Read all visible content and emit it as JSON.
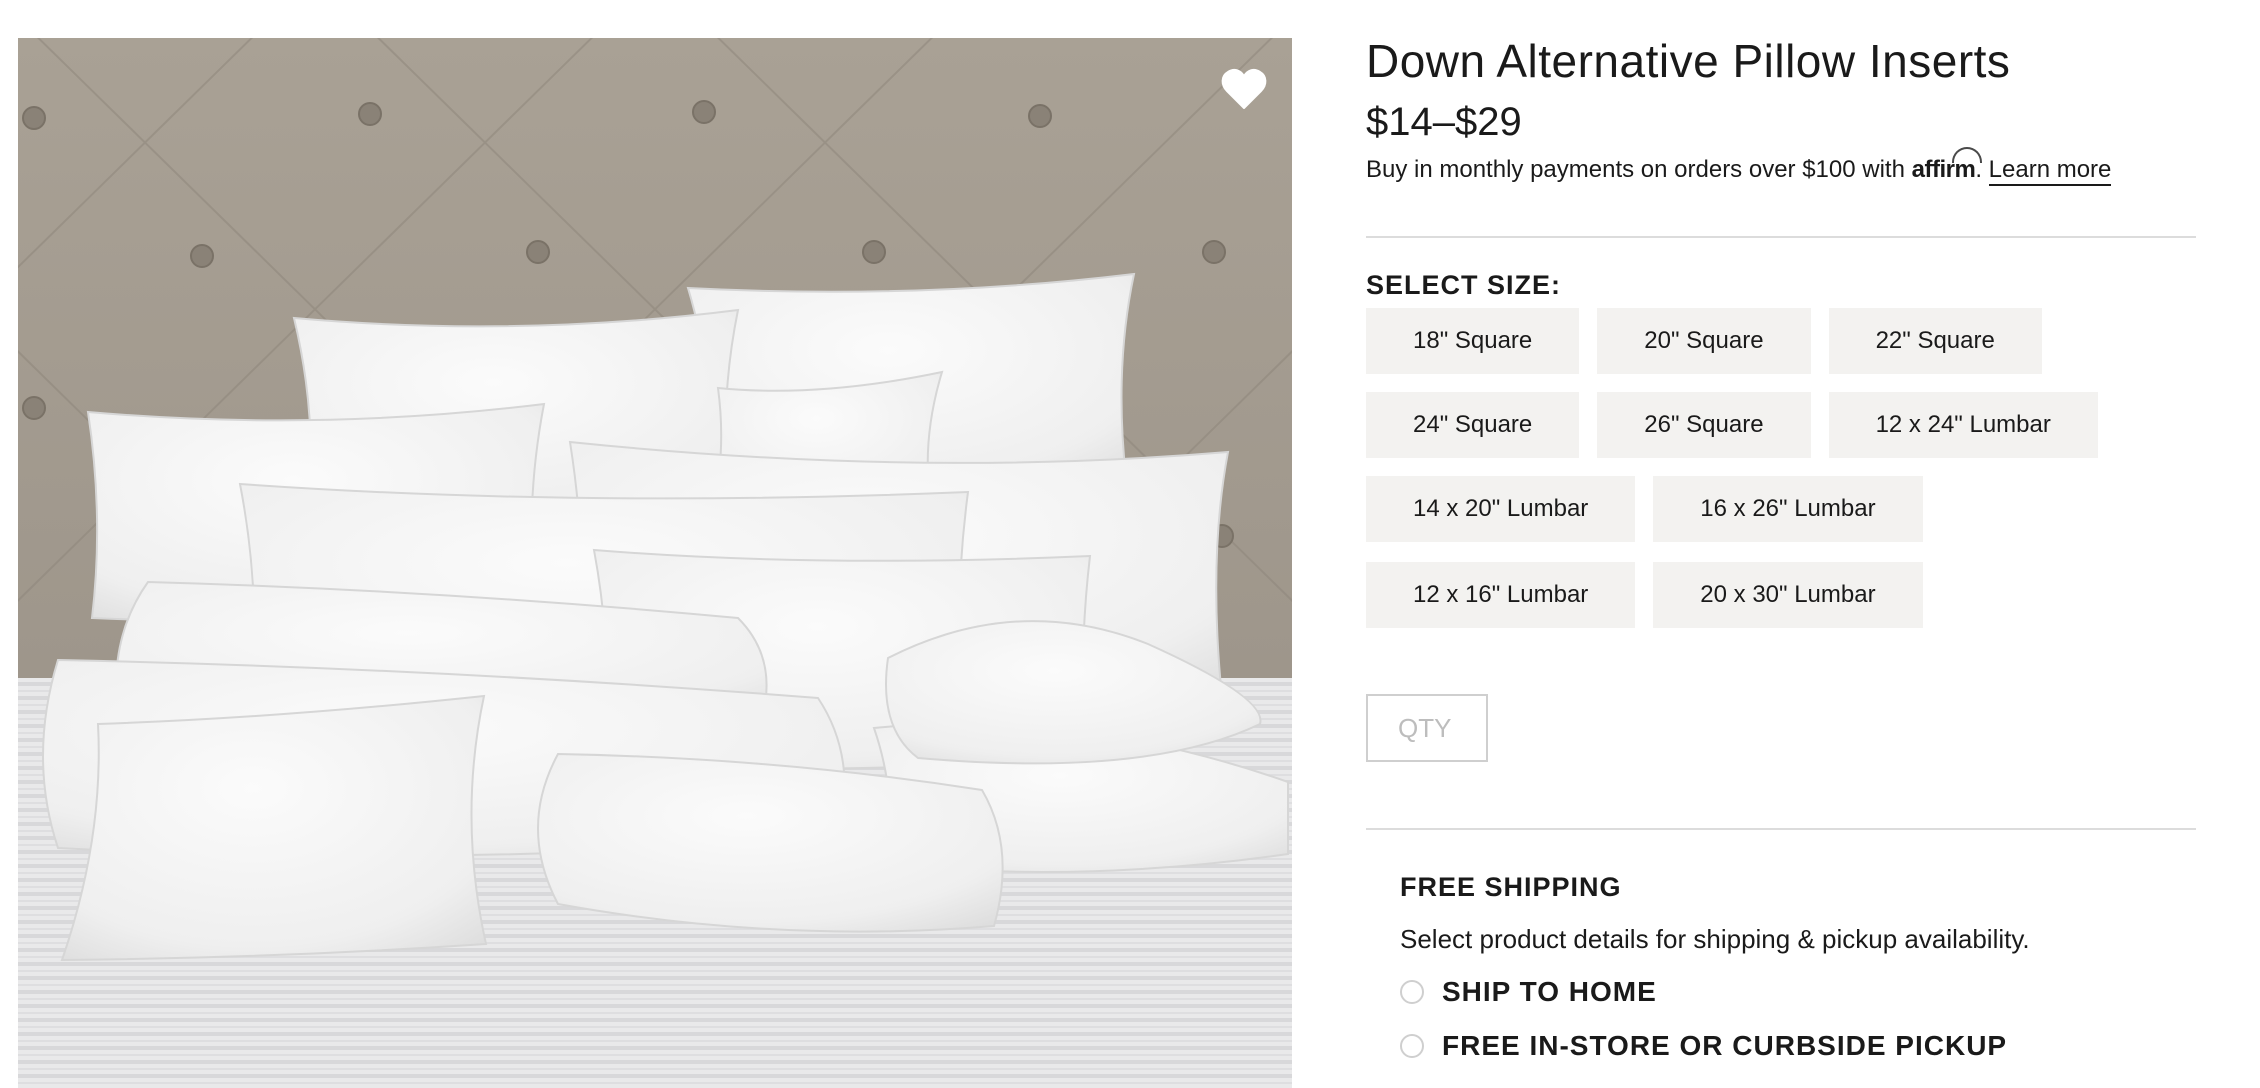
{
  "product": {
    "title": "Down Alternative Pillow Inserts",
    "price": "$14–$29",
    "financing": {
      "text_before": "Buy in monthly payments on orders over $100 with ",
      "brand": "affirm",
      "text_after": ". ",
      "learn_more": "Learn more"
    },
    "image": {
      "subject": "white pillow inserts on a bed with tufted headboard",
      "favorite_icon": "heart-icon"
    }
  },
  "size_selector": {
    "heading": "SELECT SIZE:",
    "rows": [
      [
        "18\" Square",
        "20\" Square",
        "22\" Square"
      ],
      [
        "24\" Square",
        "26\" Square",
        "12 x 24\" Lumbar"
      ],
      [
        "14 x 20\" Lumbar",
        "16 x 26\" Lumbar"
      ],
      [
        "12 x 16\" Lumbar",
        "20 x 30\" Lumbar"
      ]
    ]
  },
  "quantity": {
    "placeholder": "QTY",
    "value": ""
  },
  "shipping": {
    "heading": "FREE SHIPPING",
    "note": "Select product details for shipping & pickup availability.",
    "options": [
      {
        "label": "SHIP TO HOME",
        "selected": false
      },
      {
        "label": "FREE IN-STORE OR CURBSIDE PICKUP",
        "selected": false
      }
    ]
  },
  "colors": {
    "text": "#1a1a1a",
    "size_button_bg": "#f3f2f0",
    "divider": "#dcdcdc",
    "headboard": "#a59d91",
    "pillow": "#f4f4f4"
  }
}
